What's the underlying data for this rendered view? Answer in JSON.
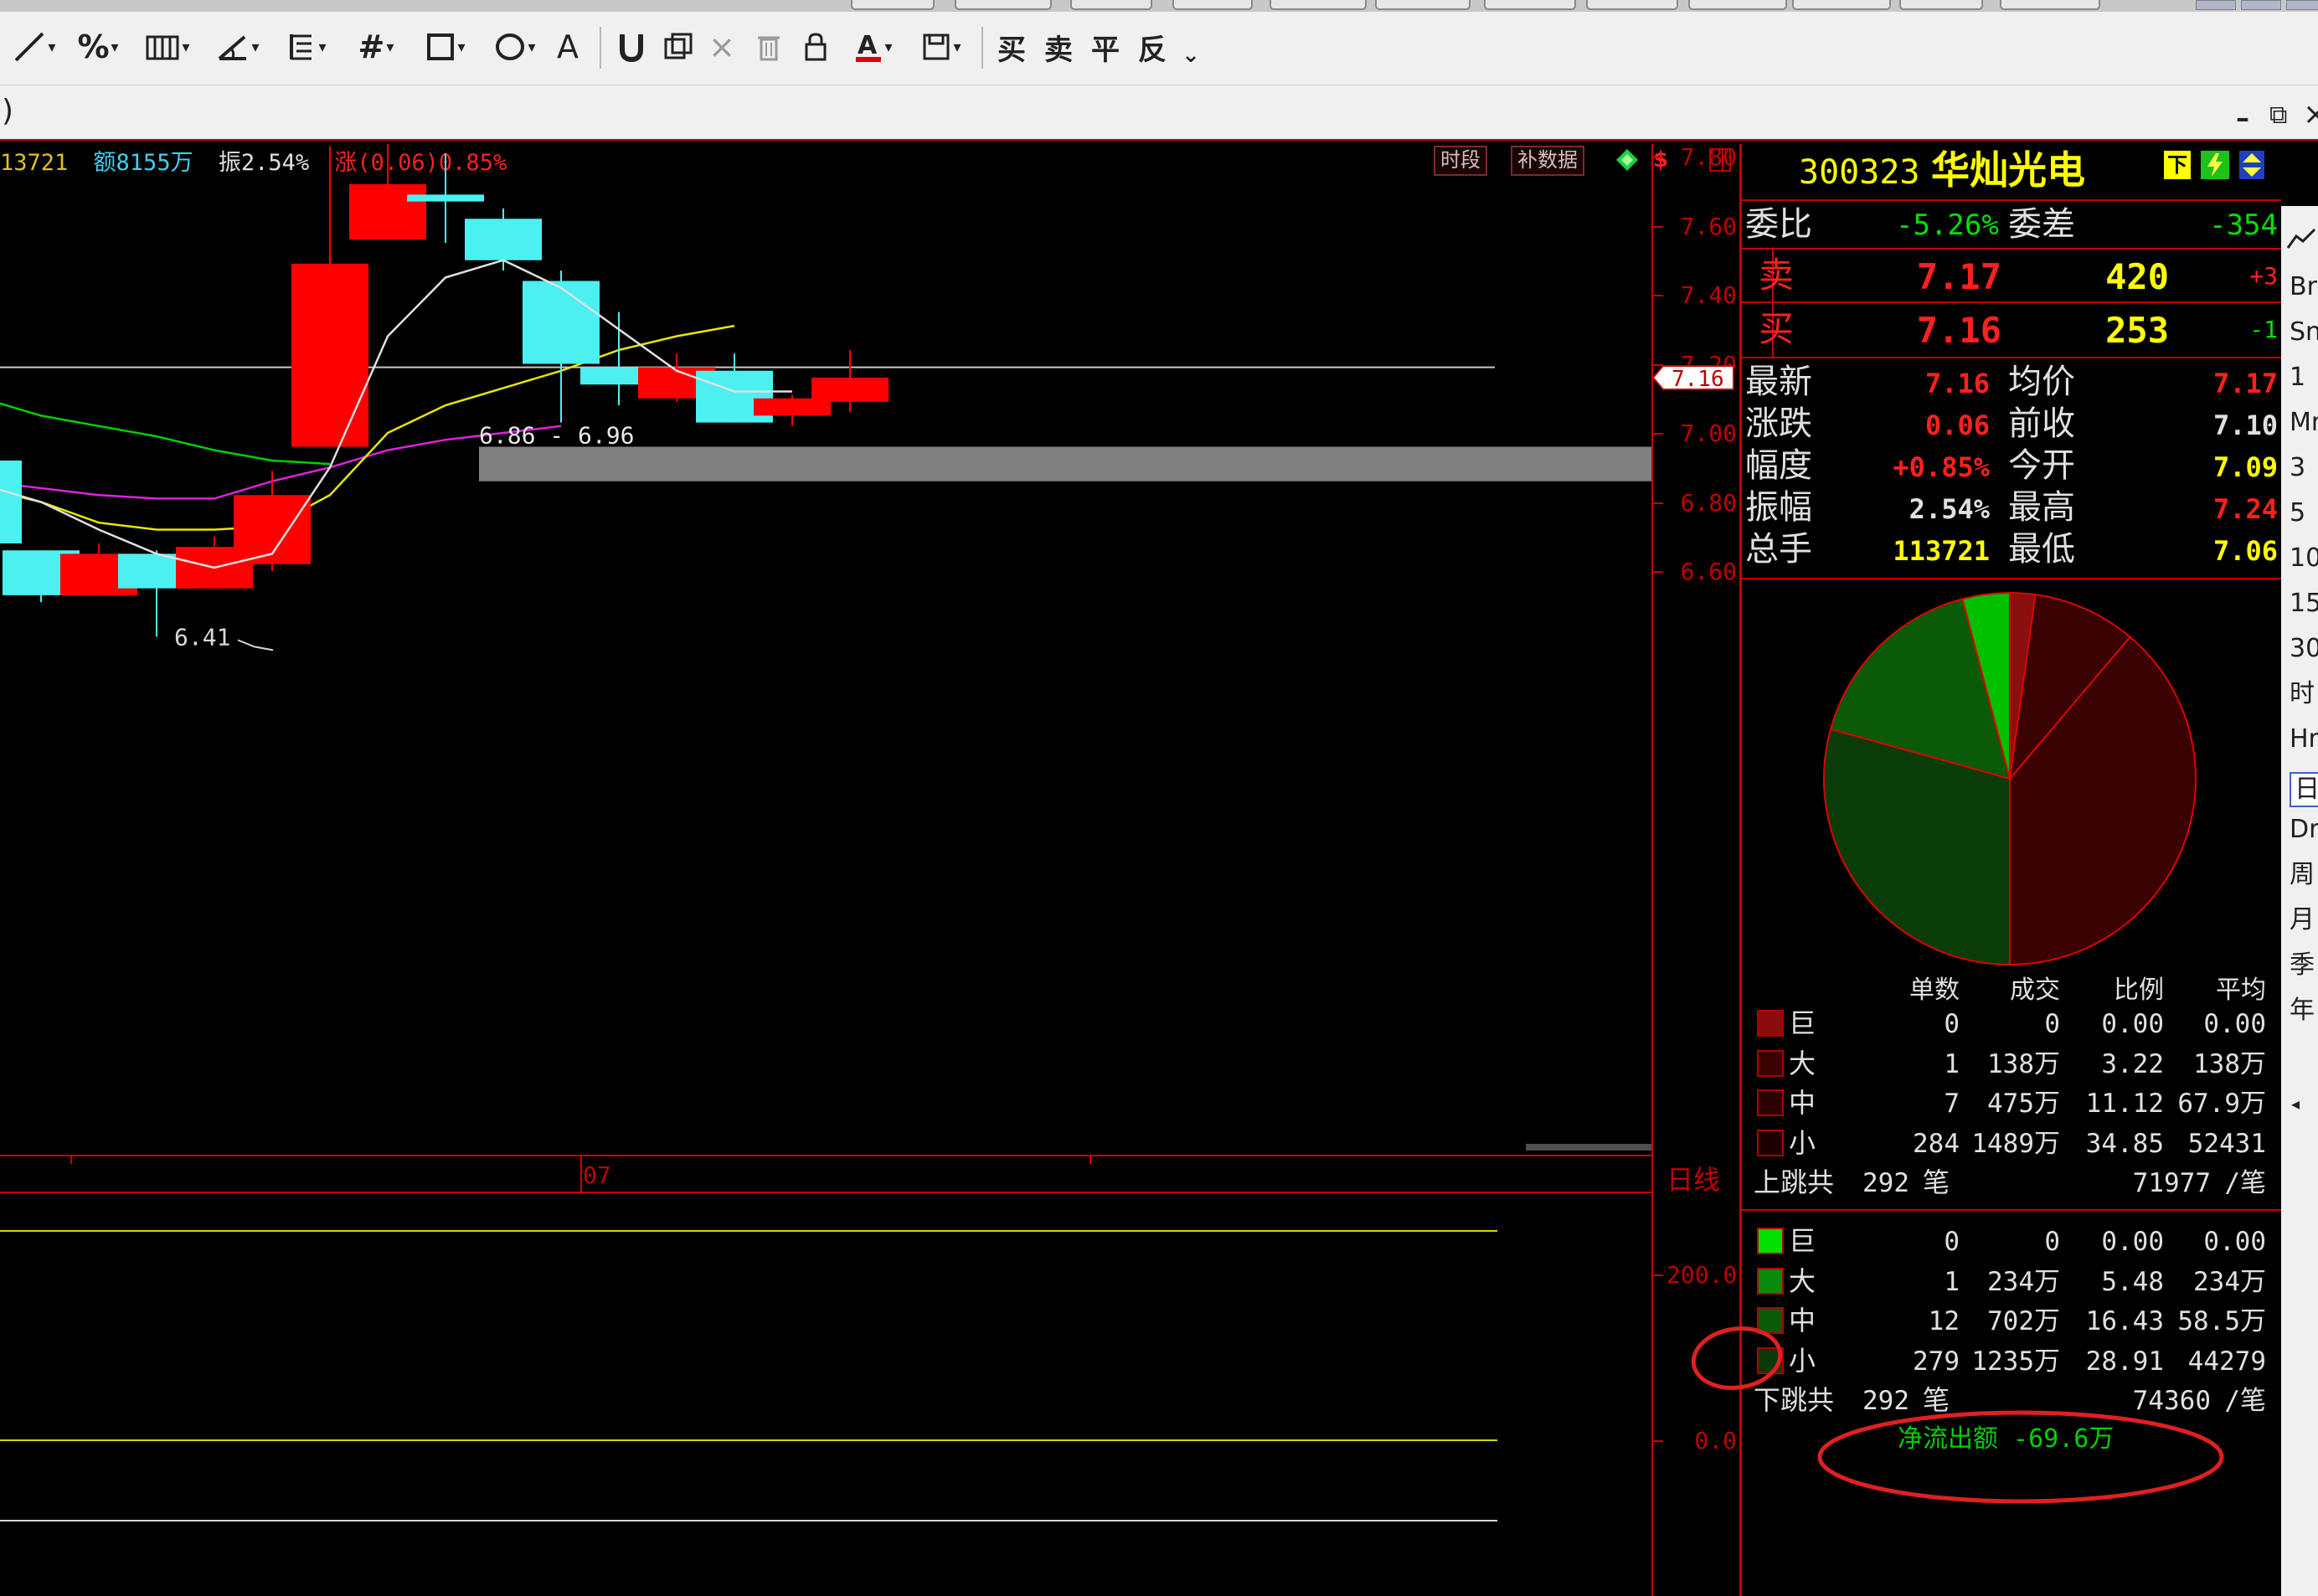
{
  "toolbar": {
    "trade_buttons": [
      "买",
      "卖",
      "平",
      "反"
    ],
    "trade_caret": "⌄"
  },
  "title_row": {
    "left_fragment": ")",
    "min": "–",
    "restore": "⧉",
    "close": "×"
  },
  "chart_header": {
    "volume": "13721",
    "amount": "额8155万",
    "amplitude": "振2.54%",
    "change": "涨(0.06)0.85%",
    "period_button": "时段",
    "fill_data_button": "补数据"
  },
  "chart_data": {
    "type": "candlestick",
    "period_label": "日线",
    "x_tick": "07",
    "ylim": [
      6.35,
      7.97
    ],
    "y_ticks": [
      "7.80",
      "7.60",
      "7.40",
      "7.20",
      "7.00",
      "6.80",
      "6.60"
    ],
    "current_price_tag": "7.16",
    "high_label": "7.88",
    "low_label": "6.41",
    "gap_zone_label": "6.86 - 6.96",
    "gap_zone": [
      6.86,
      6.96
    ],
    "candles": [
      {
        "o": 6.92,
        "c": 6.68,
        "h": 6.98,
        "l": 6.62,
        "color": "cyan"
      },
      {
        "o": 6.66,
        "c": 6.53,
        "h": 6.66,
        "l": 6.51,
        "color": "cyan"
      },
      {
        "o": 6.53,
        "c": 6.65,
        "h": 6.68,
        "l": 6.53,
        "color": "red"
      },
      {
        "o": 6.65,
        "c": 6.55,
        "h": 6.66,
        "l": 6.41,
        "color": "cyan"
      },
      {
        "o": 6.55,
        "c": 6.67,
        "h": 6.7,
        "l": 6.55,
        "color": "red"
      },
      {
        "o": 6.62,
        "c": 6.82,
        "h": 6.89,
        "l": 6.6,
        "color": "red"
      },
      {
        "o": 6.96,
        "c": 7.49,
        "h": 7.83,
        "l": 6.96,
        "color": "red"
      },
      {
        "o": 7.56,
        "c": 7.72,
        "h": 7.88,
        "l": 7.56,
        "color": "red"
      },
      {
        "o": 7.67,
        "c": 7.69,
        "h": 7.81,
        "l": 7.55,
        "color": "cyan"
      },
      {
        "o": 7.62,
        "c": 7.5,
        "h": 7.65,
        "l": 7.47,
        "color": "cyan"
      },
      {
        "o": 7.44,
        "c": 7.2,
        "h": 7.47,
        "l": 7.03,
        "color": "cyan"
      },
      {
        "o": 7.19,
        "c": 7.14,
        "h": 7.35,
        "l": 7.08,
        "color": "cyan"
      },
      {
        "o": 7.1,
        "c": 7.19,
        "h": 7.23,
        "l": 7.09,
        "color": "red"
      },
      {
        "o": 7.18,
        "c": 7.03,
        "h": 7.23,
        "l": 7.03,
        "color": "cyan"
      },
      {
        "o": 7.05,
        "c": 7.1,
        "h": 7.11,
        "l": 7.02,
        "color": "red"
      },
      {
        "o": 7.09,
        "c": 7.16,
        "h": 7.24,
        "l": 7.06,
        "color": "red"
      }
    ],
    "ma_white": [
      6.85,
      6.8,
      6.72,
      6.65,
      6.61,
      6.65,
      6.9,
      7.28,
      7.45,
      7.5,
      7.42,
      7.3,
      7.18,
      7.12,
      7.12
    ],
    "ma_yellow": [
      6.84,
      6.8,
      6.74,
      6.72,
      6.72,
      6.73,
      6.82,
      7.0,
      7.08,
      7.13,
      7.18,
      7.24,
      7.28,
      7.31
    ],
    "ma_magenta": [
      6.86,
      6.84,
      6.82,
      6.81,
      6.81,
      6.86,
      6.9,
      6.95,
      6.98,
      7.0,
      7.02
    ],
    "ma_green": [
      7.1,
      7.05,
      7.02,
      6.99,
      6.95,
      6.92,
      6.91
    ],
    "ref_line": 7.19,
    "lower_panel": {
      "labels": [
        "200.0",
        "0.0"
      ]
    }
  },
  "quote": {
    "code": "300323",
    "name": "华灿光电",
    "weibi_label": "委比",
    "weibi": "-5.26%",
    "weicha_label": "委差",
    "weicha": "-354",
    "sell_label": "卖",
    "sell_price": "7.17",
    "sell_vol": "420",
    "sell_delta": "+3",
    "buy_label": "买",
    "buy_price": "7.16",
    "buy_vol": "253",
    "buy_delta": "-1",
    "latest_label": "最新",
    "latest": "7.16",
    "avg_label": "均价",
    "avg": "7.17",
    "change_label": "涨跌",
    "change": "0.06",
    "prev_label": "前收",
    "prev": "7.10",
    "pct_label": "幅度",
    "pct": "+0.85%",
    "open_label": "今开",
    "open": "7.09",
    "amp_label": "振幅",
    "amp": "2.54%",
    "high_label": "最高",
    "high": "7.24",
    "vol_label": "总手",
    "vol": "113721",
    "low_label": "最低",
    "low": "7.06"
  },
  "flow": {
    "pie_slices": [
      {
        "value": 2.2,
        "color": "#8a1010"
      },
      {
        "value": 9.0,
        "color": "#3a0202"
      },
      {
        "value": 38.8,
        "color": "#3a0202"
      },
      {
        "value": 29.3,
        "color": "#0a3c0a"
      },
      {
        "value": 16.6,
        "color": "#0a5a0a"
      },
      {
        "value": 4.1,
        "color": "#00c000"
      }
    ],
    "headers": [
      "单数",
      "成交",
      "比例",
      "平均"
    ],
    "up_rows": [
      {
        "label": "巨",
        "count": "0",
        "amount": "0",
        "ratio": "0.00",
        "avg": "0.00",
        "color": "#8a0c0c"
      },
      {
        "label": "大",
        "count": "1",
        "amount": "138万",
        "ratio": "3.22",
        "avg": "138万",
        "color": "#3a0202"
      },
      {
        "label": "中",
        "count": "7",
        "amount": "475万",
        "ratio": "11.12",
        "avg": "67.9万",
        "color": "#2a0000"
      },
      {
        "label": "小",
        "count": "284",
        "amount": "1489万",
        "ratio": "34.85",
        "avg": "52431",
        "color": "#1a0000"
      }
    ],
    "up_total_label": "上跳共",
    "up_total": "292",
    "unit_bi": "笔",
    "up_per": "71977",
    "per_unit": "/笔",
    "down_rows": [
      {
        "label": "巨",
        "count": "0",
        "amount": "0",
        "ratio": "0.00",
        "avg": "0.00",
        "color": "#00e000"
      },
      {
        "label": "大",
        "count": "1",
        "amount": "234万",
        "ratio": "5.48",
        "avg": "234万",
        "color": "#0a8a0a"
      },
      {
        "label": "中",
        "count": "12",
        "amount": "702万",
        "ratio": "16.43",
        "avg": "58.5万",
        "color": "#0a5a0a"
      },
      {
        "label": "小",
        "count": "279",
        "amount": "1235万",
        "ratio": "28.91",
        "avg": "44279",
        "color": "#0a3a0a"
      }
    ],
    "down_total_label": "下跳共",
    "down_total": "292",
    "down_per": "74360",
    "net_label": "净流出额 -69.6万"
  },
  "sidebar": [
    "Br",
    "Sn",
    "1",
    "Mn",
    "3",
    "5",
    "10",
    "15",
    "30",
    "时",
    "Hr",
    "日",
    "Dr",
    "周",
    "月",
    "季",
    "年"
  ],
  "colors": {
    "up": "#ff0000",
    "down": "#4cf0f0",
    "axis": "#c80000",
    "yellow": "#ffff00",
    "green": "#00e000"
  }
}
